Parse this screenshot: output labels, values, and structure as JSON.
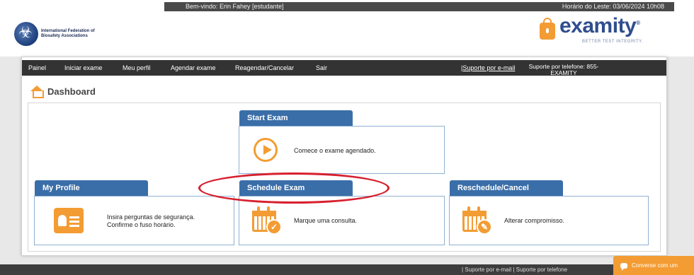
{
  "topbar": {
    "welcome": "Bem-vindo:  Erin Fahey [estudante]",
    "time": "Horário do Leste: 03/06/2024 10h08"
  },
  "header": {
    "org_name": "International Federation of Biosafety Associations",
    "brand": "examity",
    "brand_mark": "®",
    "tagline": "BETTER TEST INTEGRITY."
  },
  "nav": {
    "items": [
      "Painel",
      "Iniciar exame",
      "Meu perfil",
      "Agendar exame",
      "Reagendar/Cancelar",
      "Sair"
    ],
    "support_email": "|Suporte por e-mail",
    "support_phone": "Suporte por telefone: 855-EXAMITY"
  },
  "dashboard": {
    "title": "Dashboard"
  },
  "cards": {
    "start_exam": {
      "title": "Start Exam",
      "text": "Comece o exame agendado."
    },
    "my_profile": {
      "title": "My Profile",
      "text_line1": "Insira perguntas de segurança.",
      "text_line2": "Confirme o fuso horário."
    },
    "schedule_exam": {
      "title": "Schedule Exam",
      "text": "Marque uma consulta."
    },
    "reschedule": {
      "title": "Reschedule/Cancel",
      "text": "Alterar compromisso."
    }
  },
  "footer": {
    "links": "|  Suporte por e-mail   |  Suporte por telefone",
    "chat": "Converse com um"
  },
  "colors": {
    "accent": "#f39c33",
    "card_tab": "#3a6ea8",
    "nav_bg": "#333333",
    "highlight": "#d8202f"
  }
}
